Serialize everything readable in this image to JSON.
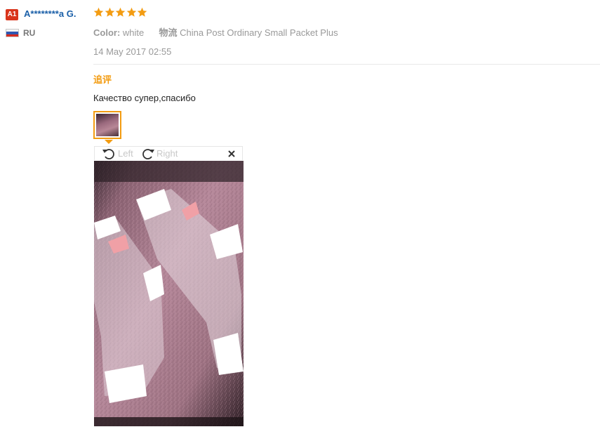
{
  "reviewer": {
    "level_badge": "A1",
    "name": "A********a G.",
    "country": "RU"
  },
  "rating": {
    "stars": 5,
    "max": 5,
    "color": "#f39c12"
  },
  "details": {
    "color_label": "Color:",
    "color_value": "white",
    "logistics_label": "物流",
    "logistics_value": "China Post Ordinary Small Packet Plus"
  },
  "date": "14 May 2017 02:55",
  "followup_label": "追评",
  "feedback_text": "Качество супер,спасибо",
  "image_viewer": {
    "rotate_left_label": "Left",
    "rotate_right_label": "Right"
  },
  "colors": {
    "accent": "#f39c12",
    "username": "#1a5fa8",
    "badge": "#d9351c"
  }
}
